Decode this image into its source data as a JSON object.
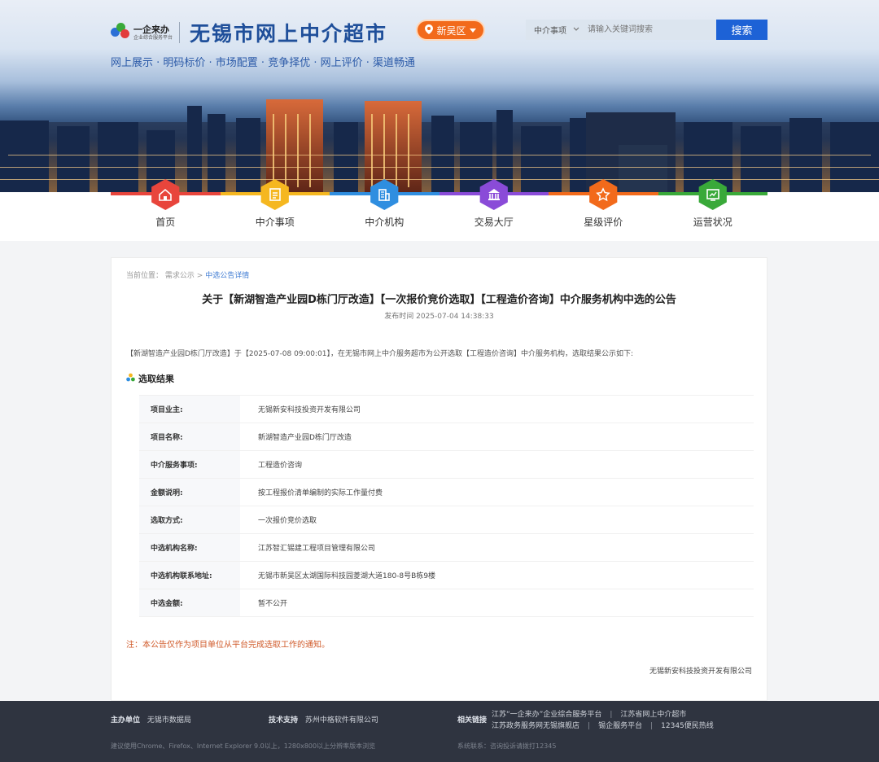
{
  "header": {
    "logo_line1": "一企来办",
    "logo_line2": "企业综合服务平台",
    "site_title": "无锡市网上中介超市",
    "region": "新吴区",
    "search_category": "中介事项",
    "search_placeholder": "请输入关键词搜索",
    "search_button": "搜索",
    "slogan": "网上展示 · 明码标价 · 市场配置 · 竞争择优 · 网上评价 · 渠道畅通"
  },
  "colors": {
    "brand_blue": "#1f4f9a",
    "search_blue": "#1d62d6",
    "region_orange": "#f26a1b",
    "note_red": "#d05a2a"
  },
  "nav": [
    {
      "label": "首页",
      "icon": "home-icon",
      "color": "#e8453c"
    },
    {
      "label": "中介事项",
      "icon": "document-icon",
      "color": "#f5b720"
    },
    {
      "label": "中介机构",
      "icon": "building-icon",
      "color": "#2f8ee0"
    },
    {
      "label": "交易大厅",
      "icon": "hall-icon",
      "color": "#8a4bd8"
    },
    {
      "label": "星级评价",
      "icon": "star-icon",
      "color": "#f26a1b"
    },
    {
      "label": "运营状况",
      "icon": "chart-icon",
      "color": "#39a939"
    }
  ],
  "breadcrumb": {
    "prefix": "当前位置：",
    "level1": "需求公示",
    "sep": " > ",
    "current": "中选公告详情"
  },
  "notice": {
    "title": "关于【新湖智造产业园D栋门厅改造】【一次报价竞价选取】【工程造价咨询】中介服务机构中选的公告",
    "publish_time": "发布时间 2025-07-04 14:38:33",
    "intro": "【新湖智造产业园D栋门厅改造】于【2025-07-08 09:00:01】，在无锡市网上中介服务超市为公开选取【工程造价咨询】中介服务机构，选取结果公示如下:",
    "section_title": "选取结果",
    "rows": [
      {
        "k": "项目业主:",
        "v": "无锡新安科技投资开发有限公司"
      },
      {
        "k": "项目名称:",
        "v": "新湖智造产业园D栋门厅改造"
      },
      {
        "k": "中介服务事项:",
        "v": "工程造价咨询"
      },
      {
        "k": "金额说明:",
        "v": "按工程报价清单编制的实际工作量付费"
      },
      {
        "k": "选取方式:",
        "v": "一次报价竞价选取"
      },
      {
        "k": "中选机构名称:",
        "v": "江苏智汇锡建工程项目管理有限公司"
      },
      {
        "k": "中选机构联系地址:",
        "v": "无锡市新吴区太湖国际科技园菱湖大道180-8号B栋9楼"
      },
      {
        "k": "中选金额:",
        "v": "暂不公开"
      }
    ],
    "note": "注：本公告仅作为项目单位从平台完成选取工作的通知。",
    "signature": "无锡新安科技投资开发有限公司"
  },
  "footer": {
    "host_label": "主办单位",
    "host_value": "无锡市数据局",
    "tech_label": "技术支持",
    "tech_value": "苏州中格软件有限公司",
    "links_label": "相关链接",
    "links": [
      "江苏“一企来办”企业综合服务平台",
      "江苏省网上中介超市",
      "江苏政务服务网无锡旗舰店",
      "锡企服务平台",
      "12345便民热线"
    ],
    "browser_note": "建议使用Chrome、Firefox、Internet Explorer 9.0以上，1280x800以上分辨率版本浏览",
    "contact_note": "系统联系：咨询投诉请拨打12345"
  }
}
